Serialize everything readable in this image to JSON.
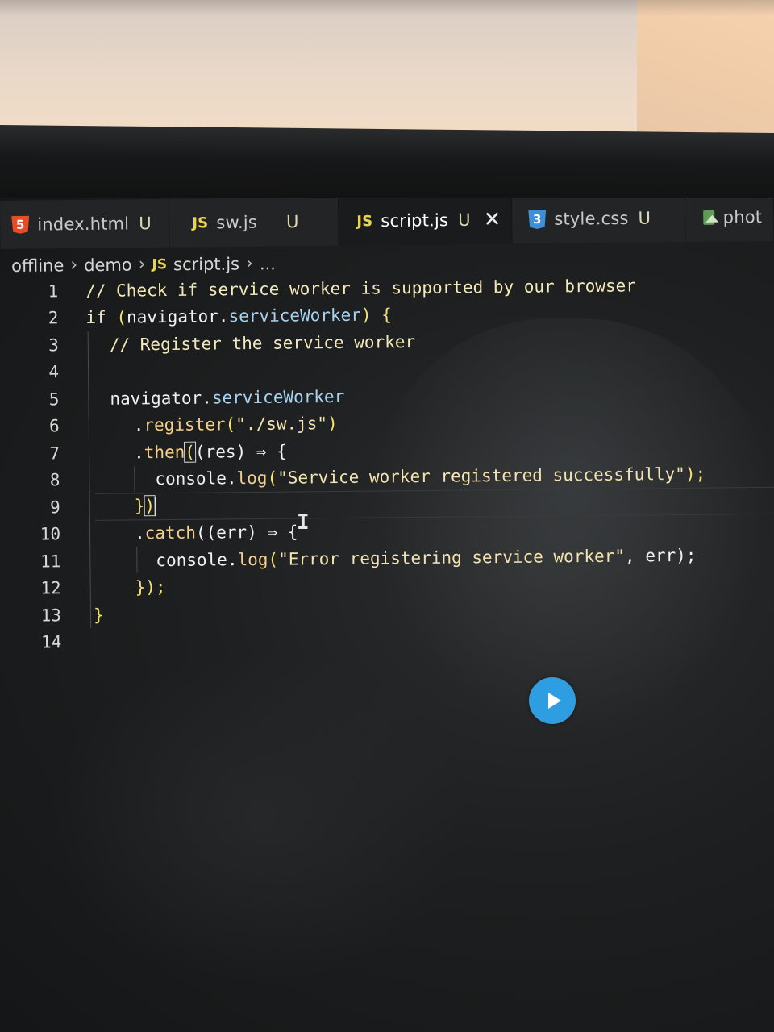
{
  "tabs": [
    {
      "icon": "html5-icon",
      "icon_text": "5",
      "label": "index.html",
      "status": "U"
    },
    {
      "icon": "js-icon",
      "icon_text": "JS",
      "label": "sw.js",
      "status": "U"
    },
    {
      "icon": "js-icon",
      "icon_text": "JS",
      "label": "script.js",
      "status": "U",
      "active": true,
      "close": "✕"
    },
    {
      "icon": "css3-icon",
      "icon_text": "3",
      "label": "style.css",
      "status": "U"
    },
    {
      "icon": "image-icon",
      "label": "phot"
    }
  ],
  "breadcrumb": {
    "folder1": "offline",
    "folder2": "demo",
    "file_icon": "JS",
    "file": "script.js",
    "more": "..."
  },
  "code": {
    "lines": [
      {
        "n": "1"
      },
      {
        "n": "2"
      },
      {
        "n": "3"
      },
      {
        "n": "4"
      },
      {
        "n": "5"
      },
      {
        "n": "6"
      },
      {
        "n": "7"
      },
      {
        "n": "8"
      },
      {
        "n": "9"
      },
      {
        "n": "10"
      },
      {
        "n": "11"
      },
      {
        "n": "12"
      },
      {
        "n": "13"
      },
      {
        "n": "14"
      }
    ],
    "l1_comment": "// Check if service worker is supported by our browser",
    "l2_if": "if",
    "l2_open": " (",
    "l2_nav": "navigator",
    "l2_dot": ".",
    "l2_sw": "serviceWorker",
    "l2_close": ") {",
    "l3_comment": "// Register the service worker",
    "l5_nav": "navigator",
    "l5_dot": ".",
    "l5_sw": "serviceWorker",
    "l6_dot": ".",
    "l6_method": "register",
    "l6_open": "(",
    "l6_str": "\"./sw.js\"",
    "l6_close": ")",
    "l7_dot": ".",
    "l7_method": "then",
    "l7_paren": "(",
    "l7_rest": "(res) ⇒ {",
    "l8_console": "console",
    "l8_dot": ".",
    "l8_log": "log",
    "l8_open": "(",
    "l8_str": "\"Service worker registered successfully\"",
    "l8_close": ");",
    "l9_brace": "}",
    "l9_paren": ")",
    "l10_dot": ".",
    "l10_method": "catch",
    "l10_rest": "((err) ⇒ {",
    "l11_console": "console",
    "l11_dot": ".",
    "l11_log": "log",
    "l11_open": "(",
    "l11_str": "\"Error registering service worker\"",
    "l11_rest": ", err);",
    "l12_text": "});",
    "l13_text": "}"
  },
  "colors": {
    "accent_play": "#2f9de2",
    "js_icon": "#e8d44d",
    "html_icon": "#e44d26",
    "css_icon": "#3f8fd8"
  }
}
